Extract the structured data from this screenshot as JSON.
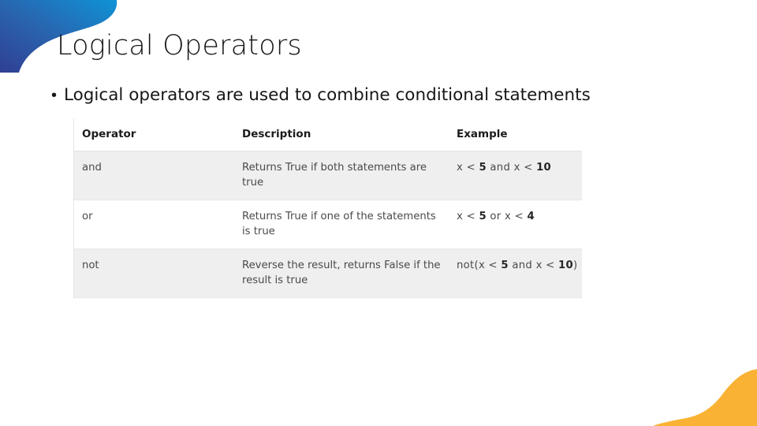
{
  "slide": {
    "title": "Logical Operators",
    "bullet_marker": "•",
    "bullet_text": "Logical operators are used to combine conditional statements"
  },
  "decor": {
    "blue_gradient_start": "#2e3f92",
    "blue_gradient_mid": "#2a63ad",
    "blue_gradient_end": "#1192d4",
    "orange": "#f9b233"
  },
  "table": {
    "headers": {
      "operator": "Operator",
      "description": "Description",
      "example": "Example"
    },
    "rows": [
      {
        "operator": "and",
        "description": "Returns True if both statements are true",
        "example_parts": [
          "x < ",
          "5",
          " and  x < ",
          "10"
        ],
        "example_plain": "x < 5 and  x < 10",
        "shaded": true
      },
      {
        "operator": "or",
        "description": "Returns True if one of the statements is true",
        "example_parts": [
          "x < ",
          "5",
          " or x < ",
          "4"
        ],
        "example_plain": "x < 5 or x < 4",
        "shaded": false
      },
      {
        "operator": "not",
        "description": "Reverse the result, returns False if the result is true",
        "example_parts": [
          "not(x < ",
          "5",
          " and x < ",
          "10",
          ")"
        ],
        "example_plain": "not(x < 5 and x < 10)",
        "shaded": true
      }
    ]
  }
}
